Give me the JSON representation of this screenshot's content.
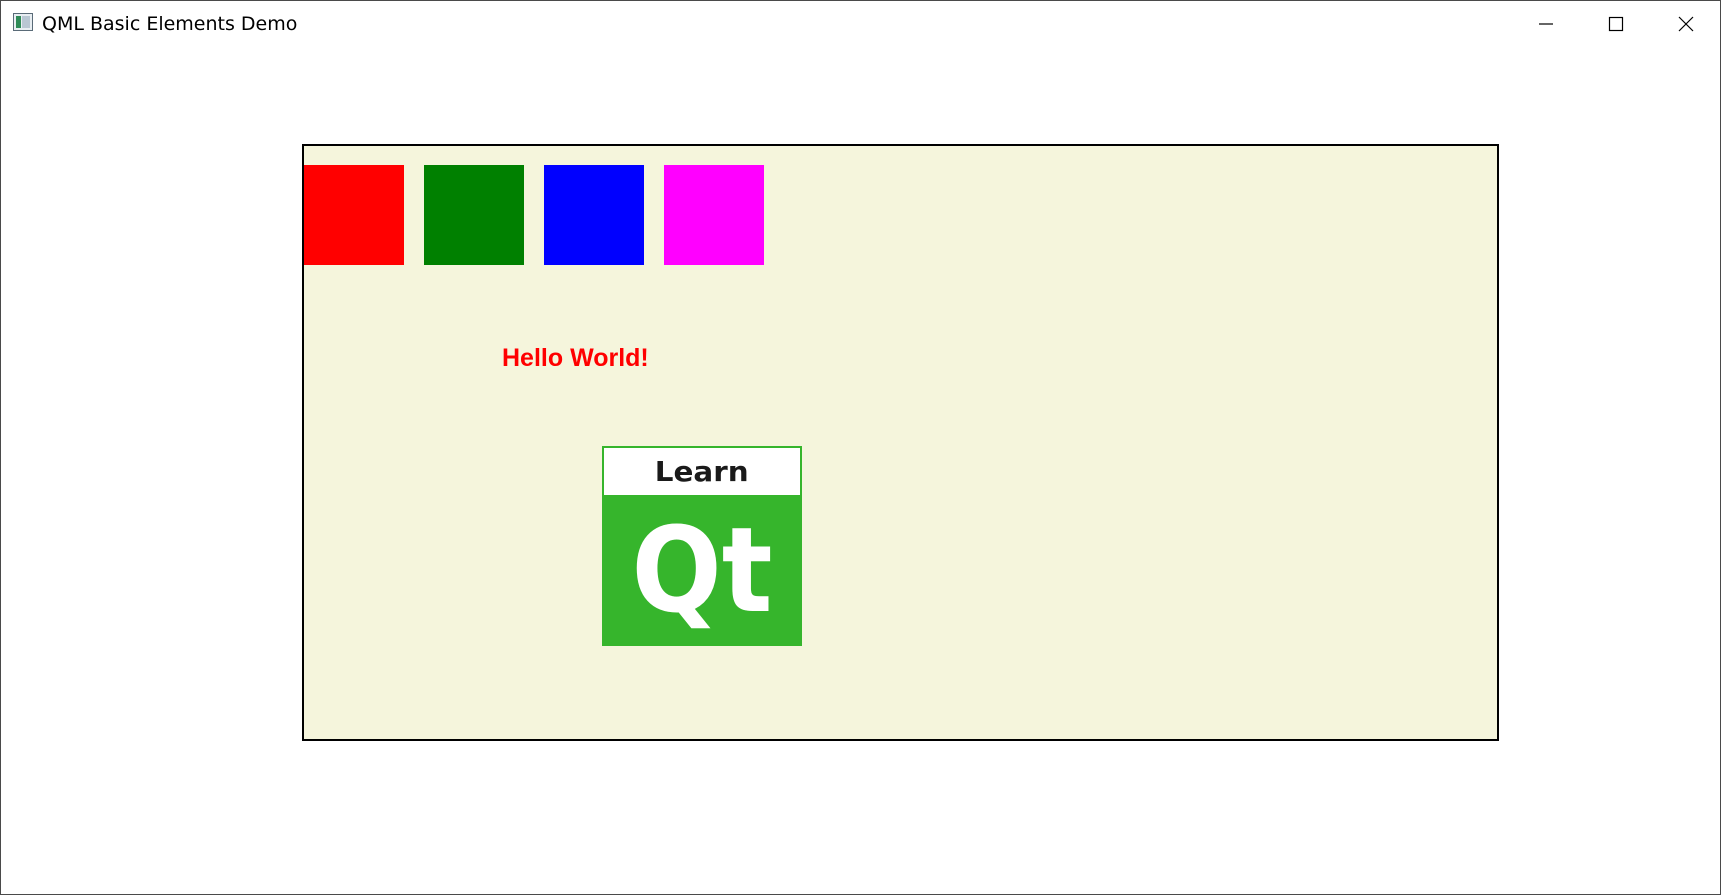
{
  "window": {
    "title": "QML Basic Elements Demo",
    "icon": "qt-app-icon",
    "controls": {
      "minimize": "minimize-icon",
      "maximize": "maximize-icon",
      "close": "close-icon"
    }
  },
  "scene": {
    "background_color": "#f5f5dc",
    "border_color": "#000000",
    "squares": [
      {
        "name": "red",
        "color": "#ff0000"
      },
      {
        "name": "green",
        "color": "#008000"
      },
      {
        "name": "blue",
        "color": "#0000ff"
      },
      {
        "name": "magenta",
        "color": "#ff00ff"
      }
    ],
    "hello_text": "Hello World!",
    "hello_color": "#ff0000",
    "logo": {
      "top_text": "Learn",
      "main_text": "Qt",
      "brand_color": "#36b52c"
    }
  }
}
